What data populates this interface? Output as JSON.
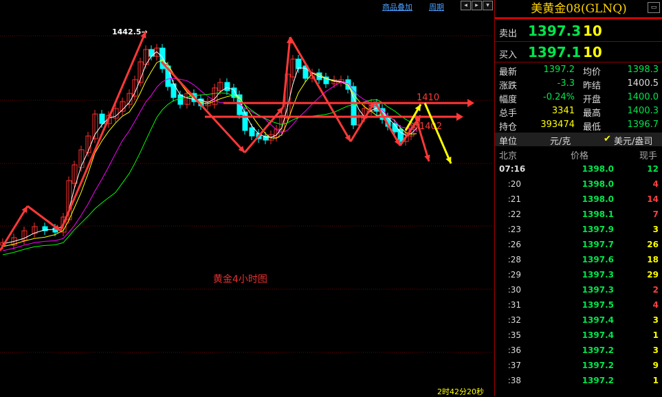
{
  "toolbar": {
    "overlay_label": "商品叠加",
    "period_label": "周期"
  },
  "chart": {
    "caption": "黄金4小时图",
    "countdown": "2时42分20秒",
    "annotations": {
      "high": "1442.5",
      "level_1410": "1410",
      "level_1402": "1402"
    },
    "colors": {
      "up": "#ff3030",
      "down": "#00ffff",
      "grid": "#7a0000",
      "ma5": "#ffffff",
      "ma10": "#ffff00",
      "ma20": "#ff00ff",
      "ma40": "#00ff00",
      "arrow_red": "#ff3838",
      "arrow_yellow": "#ffff00"
    }
  },
  "panel": {
    "title": "美黄金08(GLNQ)",
    "sell": {
      "label": "卖出",
      "price": "1397.3",
      "vol": "10"
    },
    "buy": {
      "label": "买入",
      "price": "1397.1",
      "vol": "10"
    },
    "stats": [
      {
        "l1": "最新",
        "v1": "1397.2",
        "c1": "dn",
        "l2": "均价",
        "v2": "1398.3",
        "c2": "dn"
      },
      {
        "l1": "涨跌",
        "v1": "-3.3",
        "c1": "dn",
        "l2": "昨结",
        "v2": "1400.5",
        "c2": "lbl"
      },
      {
        "l1": "幅度",
        "v1": "-0.24%",
        "c1": "dn",
        "l2": "开盘",
        "v2": "1400.0",
        "c2": "dn"
      },
      {
        "l1": "总手",
        "v1": "3341",
        "c1": "yl",
        "l2": "最高",
        "v2": "1400.3",
        "c2": "dn"
      },
      {
        "l1": "持仓",
        "v1": "393474",
        "c1": "yl",
        "l2": "最低",
        "v2": "1396.7",
        "c2": "dn"
      }
    ],
    "unit": {
      "label": "单位",
      "value": "元/克",
      "option": "美元/盎司",
      "check": "✔"
    },
    "tick_header": {
      "location": "北京",
      "price": "价格",
      "vol": "现手"
    },
    "ticks": [
      {
        "time": "07:16",
        "price": "1398.0",
        "vol": "12",
        "dir": "dn"
      },
      {
        "time": ":20",
        "price": "1398.0",
        "vol": "4",
        "dir": "up"
      },
      {
        "time": ":21",
        "price": "1398.0",
        "vol": "14",
        "dir": "up"
      },
      {
        "time": ":22",
        "price": "1398.1",
        "vol": "7",
        "dir": "up"
      },
      {
        "time": ":23",
        "price": "1397.9",
        "vol": "3",
        "dir": "yl"
      },
      {
        "time": ":26",
        "price": "1397.7",
        "vol": "26",
        "dir": "yl"
      },
      {
        "time": ":28",
        "price": "1397.6",
        "vol": "18",
        "dir": "yl"
      },
      {
        "time": ":29",
        "price": "1397.3",
        "vol": "29",
        "dir": "yl"
      },
      {
        "time": ":30",
        "price": "1397.3",
        "vol": "2",
        "dir": "up"
      },
      {
        "time": ":31",
        "price": "1397.5",
        "vol": "4",
        "dir": "up"
      },
      {
        "time": ":32",
        "price": "1397.4",
        "vol": "3",
        "dir": "yl"
      },
      {
        "time": ":35",
        "price": "1397.4",
        "vol": "1",
        "dir": "yl"
      },
      {
        "time": ":36",
        "price": "1397.2",
        "vol": "3",
        "dir": "yl"
      },
      {
        "time": ":37",
        "price": "1397.2",
        "vol": "9",
        "dir": "yl"
      },
      {
        "time": ":38",
        "price": "1397.2",
        "vol": "1",
        "dir": "yl"
      }
    ]
  }
}
